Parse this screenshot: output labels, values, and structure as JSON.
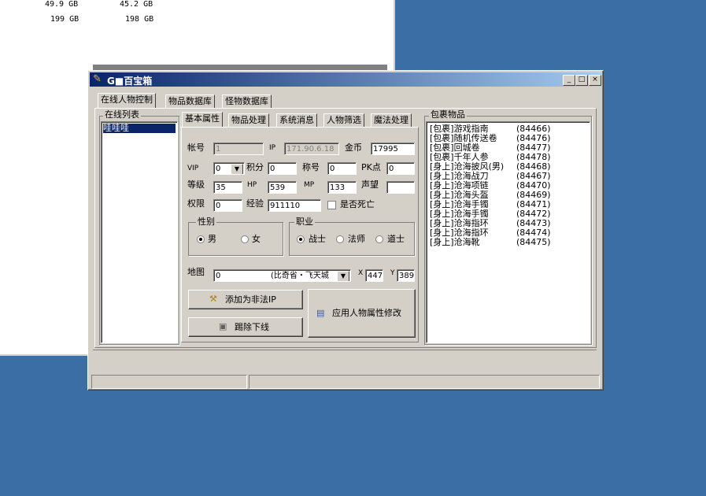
{
  "background_window": {
    "rows": [
      {
        "a": "49.9 GB",
        "b": "45.2 GB"
      },
      {
        "a": "199 GB",
        "b": "198 GB"
      }
    ]
  },
  "window": {
    "title": "G■百宝箱",
    "controls": {
      "min": "_",
      "max": "□",
      "close": "×"
    }
  },
  "main_tabs": [
    "在线人物控制",
    "物品数据库",
    "怪物数据库"
  ],
  "online_list": {
    "title": "在线列表",
    "items": [
      "哇哇哇"
    ]
  },
  "sub_tabs": [
    "基本属性",
    "物品处理",
    "系统消息",
    "人物筛选",
    "魔法处理"
  ],
  "form": {
    "account_label": "帐号",
    "account_value": "1",
    "ip_label": "IP",
    "ip_value": "171.90.6.18",
    "gold_label": "金币",
    "gold_value": "17995",
    "vip_label": "VIP",
    "vip_value": "0",
    "points_label": "积分",
    "points_value": "0",
    "title_label": "称号",
    "title_value": "0",
    "pk_label": "PK点",
    "pk_value": "0",
    "level_label": "等级",
    "level_value": "35",
    "hp_label": "HP",
    "hp_value": "539",
    "mp_label": "MP",
    "mp_value": "133",
    "fame_label": "声望",
    "fame_value": "",
    "perm_label": "权限",
    "perm_value": "0",
    "exp_label": "经验",
    "exp_value": "911110",
    "dead_label": "是否死亡",
    "gender": {
      "title": "性别",
      "male": "男",
      "female": "女",
      "selected": "男"
    },
    "job": {
      "title": "职业",
      "warrior": "战士",
      "mage": "法师",
      "taoist": "道士",
      "selected": "战士"
    },
    "map_label": "地图",
    "map_value": "0",
    "map_name": "(比奇省・飞天城",
    "x_label": "X",
    "x_value": "447",
    "y_label": "Y",
    "y_value": "389",
    "btn_add_ip": "添加为非法IP",
    "btn_kick": "踢除下线",
    "btn_apply": "应用人物属性修改"
  },
  "bag": {
    "title": "包裹物品",
    "items": [
      {
        "name": "[包裹]游戏指南",
        "id": "(84466)"
      },
      {
        "name": "[包裹]随机传送卷",
        "id": "(84476)"
      },
      {
        "name": "[包裹]回城卷",
        "id": "(84477)"
      },
      {
        "name": "[包裹]千年人参",
        "id": "(84478)"
      },
      {
        "name": "[身上]沧海披风(男)",
        "id": "(84468)"
      },
      {
        "name": "[身上]沧海战刀",
        "id": "(84467)"
      },
      {
        "name": "[身上]沧海项链",
        "id": "(84470)"
      },
      {
        "name": "[身上]沧海头盔",
        "id": "(84469)"
      },
      {
        "name": "[身上]沧海手镯",
        "id": "(84471)"
      },
      {
        "name": "[身上]沧海手镯",
        "id": "(84472)"
      },
      {
        "name": "[身上]沧海指环",
        "id": "(84473)"
      },
      {
        "name": "[身上]沧海指环",
        "id": "(84474)"
      },
      {
        "name": "[身上]沧海靴",
        "id": "(84475)"
      }
    ]
  }
}
